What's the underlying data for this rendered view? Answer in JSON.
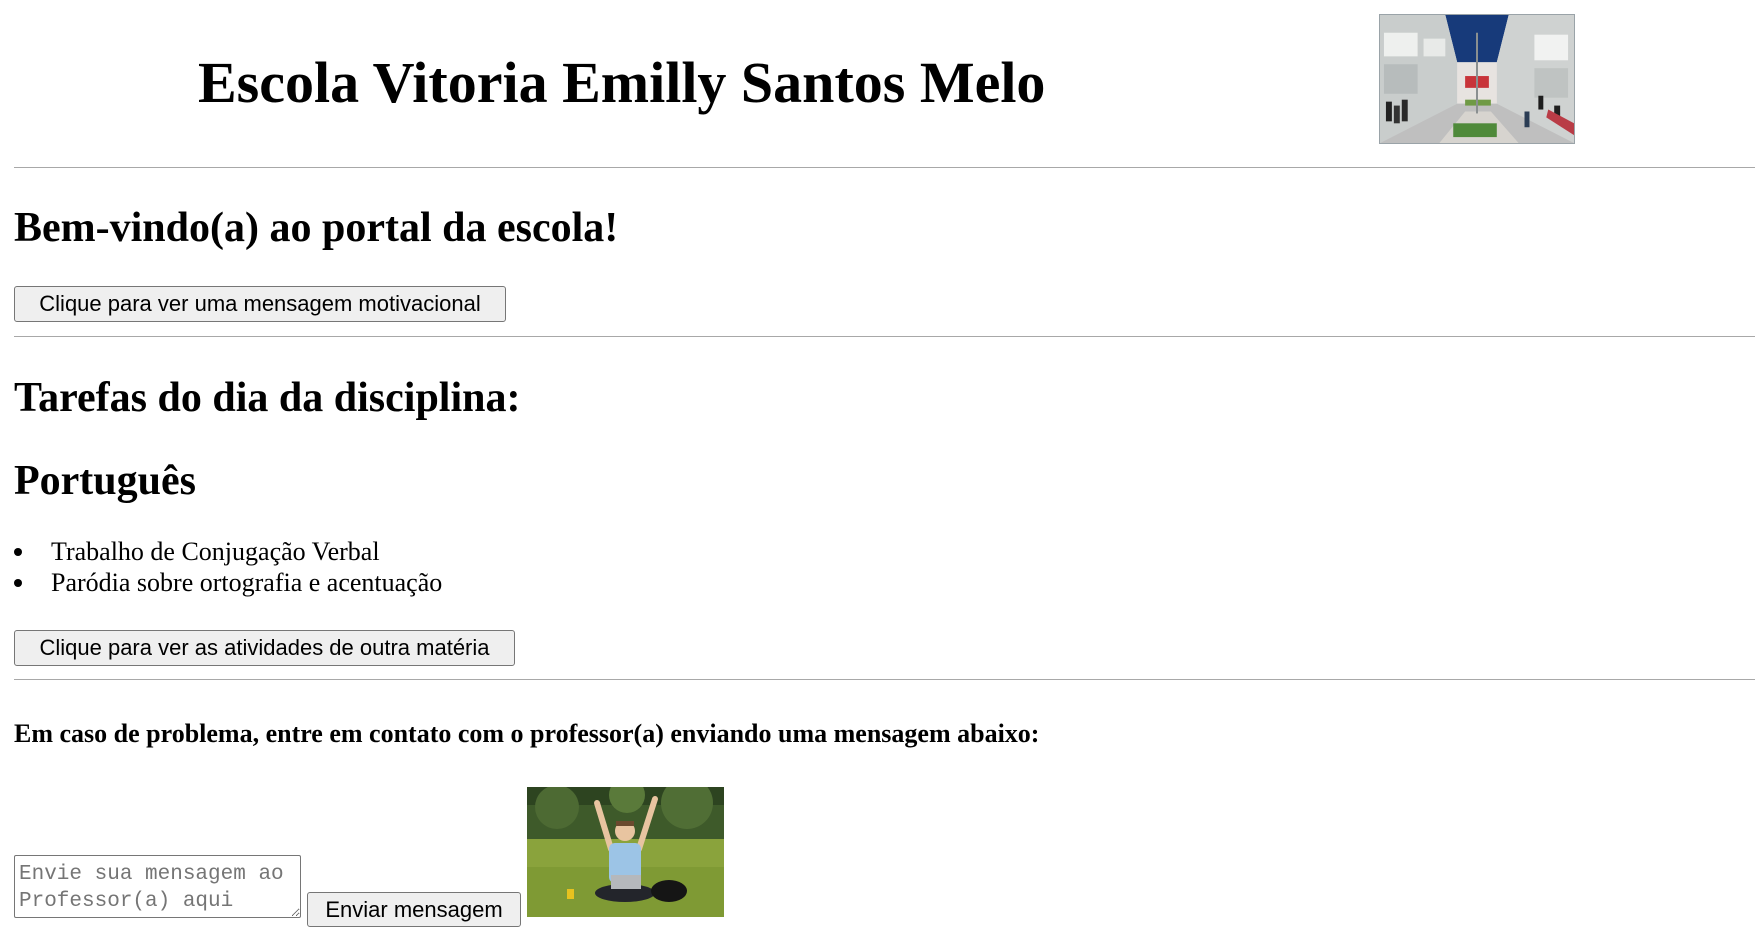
{
  "header": {
    "title": "Escola Vitoria Emilly Santos Melo",
    "school_photo": "school-courtyard-photo"
  },
  "welcome": {
    "heading": "Bem-vindo(a) ao portal da escola!",
    "motivational_button": "Clique para ver uma mensagem motivacional"
  },
  "tasks": {
    "heading": "Tarefas do dia da disciplina:",
    "subject": "Português",
    "items": [
      "Trabalho de Conjugação Verbal",
      "Paródia sobre ortografia e acentuação"
    ],
    "other_subject_button": "Clique para ver as atividades de outra matéria"
  },
  "contact": {
    "text": "Em caso de problema, entre em contato com o professor(a) enviando uma mensagem abaixo:",
    "message_placeholder": "Envie sua mensagem ao Professor(a) aqui",
    "message_value": "",
    "send_button": "Enviar mensagem",
    "student_photo": "happy-student-photo"
  },
  "colors": {
    "rule": "#a8a8a8",
    "button_bg": "#efefef",
    "button_border": "#767676"
  }
}
